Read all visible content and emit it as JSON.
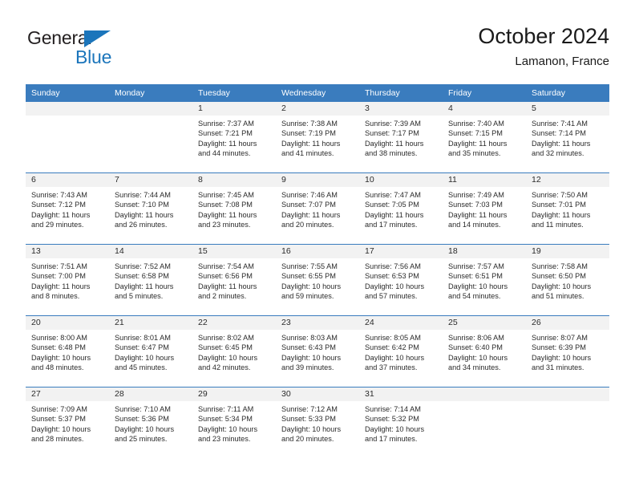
{
  "brand": {
    "name_part1": "General",
    "name_part2": "Blue",
    "triangle_color": "#1b75bb"
  },
  "header": {
    "title": "October 2024",
    "subtitle": "Lamanon, France",
    "header_bg": "#3a7cbe",
    "band_bg": "#f2f2f2"
  },
  "weekdays": [
    "Sunday",
    "Monday",
    "Tuesday",
    "Wednesday",
    "Thursday",
    "Friday",
    "Saturday"
  ],
  "weeks": [
    [
      {
        "day": "",
        "sunrise": "",
        "sunset": "",
        "daylight_line1": "",
        "daylight_line2": ""
      },
      {
        "day": "",
        "sunrise": "",
        "sunset": "",
        "daylight_line1": "",
        "daylight_line2": ""
      },
      {
        "day": "1",
        "sunrise": "Sunrise: 7:37 AM",
        "sunset": "Sunset: 7:21 PM",
        "daylight_line1": "Daylight: 11 hours",
        "daylight_line2": "and 44 minutes."
      },
      {
        "day": "2",
        "sunrise": "Sunrise: 7:38 AM",
        "sunset": "Sunset: 7:19 PM",
        "daylight_line1": "Daylight: 11 hours",
        "daylight_line2": "and 41 minutes."
      },
      {
        "day": "3",
        "sunrise": "Sunrise: 7:39 AM",
        "sunset": "Sunset: 7:17 PM",
        "daylight_line1": "Daylight: 11 hours",
        "daylight_line2": "and 38 minutes."
      },
      {
        "day": "4",
        "sunrise": "Sunrise: 7:40 AM",
        "sunset": "Sunset: 7:15 PM",
        "daylight_line1": "Daylight: 11 hours",
        "daylight_line2": "and 35 minutes."
      },
      {
        "day": "5",
        "sunrise": "Sunrise: 7:41 AM",
        "sunset": "Sunset: 7:14 PM",
        "daylight_line1": "Daylight: 11 hours",
        "daylight_line2": "and 32 minutes."
      }
    ],
    [
      {
        "day": "6",
        "sunrise": "Sunrise: 7:43 AM",
        "sunset": "Sunset: 7:12 PM",
        "daylight_line1": "Daylight: 11 hours",
        "daylight_line2": "and 29 minutes."
      },
      {
        "day": "7",
        "sunrise": "Sunrise: 7:44 AM",
        "sunset": "Sunset: 7:10 PM",
        "daylight_line1": "Daylight: 11 hours",
        "daylight_line2": "and 26 minutes."
      },
      {
        "day": "8",
        "sunrise": "Sunrise: 7:45 AM",
        "sunset": "Sunset: 7:08 PM",
        "daylight_line1": "Daylight: 11 hours",
        "daylight_line2": "and 23 minutes."
      },
      {
        "day": "9",
        "sunrise": "Sunrise: 7:46 AM",
        "sunset": "Sunset: 7:07 PM",
        "daylight_line1": "Daylight: 11 hours",
        "daylight_line2": "and 20 minutes."
      },
      {
        "day": "10",
        "sunrise": "Sunrise: 7:47 AM",
        "sunset": "Sunset: 7:05 PM",
        "daylight_line1": "Daylight: 11 hours",
        "daylight_line2": "and 17 minutes."
      },
      {
        "day": "11",
        "sunrise": "Sunrise: 7:49 AM",
        "sunset": "Sunset: 7:03 PM",
        "daylight_line1": "Daylight: 11 hours",
        "daylight_line2": "and 14 minutes."
      },
      {
        "day": "12",
        "sunrise": "Sunrise: 7:50 AM",
        "sunset": "Sunset: 7:01 PM",
        "daylight_line1": "Daylight: 11 hours",
        "daylight_line2": "and 11 minutes."
      }
    ],
    [
      {
        "day": "13",
        "sunrise": "Sunrise: 7:51 AM",
        "sunset": "Sunset: 7:00 PM",
        "daylight_line1": "Daylight: 11 hours",
        "daylight_line2": "and 8 minutes."
      },
      {
        "day": "14",
        "sunrise": "Sunrise: 7:52 AM",
        "sunset": "Sunset: 6:58 PM",
        "daylight_line1": "Daylight: 11 hours",
        "daylight_line2": "and 5 minutes."
      },
      {
        "day": "15",
        "sunrise": "Sunrise: 7:54 AM",
        "sunset": "Sunset: 6:56 PM",
        "daylight_line1": "Daylight: 11 hours",
        "daylight_line2": "and 2 minutes."
      },
      {
        "day": "16",
        "sunrise": "Sunrise: 7:55 AM",
        "sunset": "Sunset: 6:55 PM",
        "daylight_line1": "Daylight: 10 hours",
        "daylight_line2": "and 59 minutes."
      },
      {
        "day": "17",
        "sunrise": "Sunrise: 7:56 AM",
        "sunset": "Sunset: 6:53 PM",
        "daylight_line1": "Daylight: 10 hours",
        "daylight_line2": "and 57 minutes."
      },
      {
        "day": "18",
        "sunrise": "Sunrise: 7:57 AM",
        "sunset": "Sunset: 6:51 PM",
        "daylight_line1": "Daylight: 10 hours",
        "daylight_line2": "and 54 minutes."
      },
      {
        "day": "19",
        "sunrise": "Sunrise: 7:58 AM",
        "sunset": "Sunset: 6:50 PM",
        "daylight_line1": "Daylight: 10 hours",
        "daylight_line2": "and 51 minutes."
      }
    ],
    [
      {
        "day": "20",
        "sunrise": "Sunrise: 8:00 AM",
        "sunset": "Sunset: 6:48 PM",
        "daylight_line1": "Daylight: 10 hours",
        "daylight_line2": "and 48 minutes."
      },
      {
        "day": "21",
        "sunrise": "Sunrise: 8:01 AM",
        "sunset": "Sunset: 6:47 PM",
        "daylight_line1": "Daylight: 10 hours",
        "daylight_line2": "and 45 minutes."
      },
      {
        "day": "22",
        "sunrise": "Sunrise: 8:02 AM",
        "sunset": "Sunset: 6:45 PM",
        "daylight_line1": "Daylight: 10 hours",
        "daylight_line2": "and 42 minutes."
      },
      {
        "day": "23",
        "sunrise": "Sunrise: 8:03 AM",
        "sunset": "Sunset: 6:43 PM",
        "daylight_line1": "Daylight: 10 hours",
        "daylight_line2": "and 39 minutes."
      },
      {
        "day": "24",
        "sunrise": "Sunrise: 8:05 AM",
        "sunset": "Sunset: 6:42 PM",
        "daylight_line1": "Daylight: 10 hours",
        "daylight_line2": "and 37 minutes."
      },
      {
        "day": "25",
        "sunrise": "Sunrise: 8:06 AM",
        "sunset": "Sunset: 6:40 PM",
        "daylight_line1": "Daylight: 10 hours",
        "daylight_line2": "and 34 minutes."
      },
      {
        "day": "26",
        "sunrise": "Sunrise: 8:07 AM",
        "sunset": "Sunset: 6:39 PM",
        "daylight_line1": "Daylight: 10 hours",
        "daylight_line2": "and 31 minutes."
      }
    ],
    [
      {
        "day": "27",
        "sunrise": "Sunrise: 7:09 AM",
        "sunset": "Sunset: 5:37 PM",
        "daylight_line1": "Daylight: 10 hours",
        "daylight_line2": "and 28 minutes."
      },
      {
        "day": "28",
        "sunrise": "Sunrise: 7:10 AM",
        "sunset": "Sunset: 5:36 PM",
        "daylight_line1": "Daylight: 10 hours",
        "daylight_line2": "and 25 minutes."
      },
      {
        "day": "29",
        "sunrise": "Sunrise: 7:11 AM",
        "sunset": "Sunset: 5:34 PM",
        "daylight_line1": "Daylight: 10 hours",
        "daylight_line2": "and 23 minutes."
      },
      {
        "day": "30",
        "sunrise": "Sunrise: 7:12 AM",
        "sunset": "Sunset: 5:33 PM",
        "daylight_line1": "Daylight: 10 hours",
        "daylight_line2": "and 20 minutes."
      },
      {
        "day": "31",
        "sunrise": "Sunrise: 7:14 AM",
        "sunset": "Sunset: 5:32 PM",
        "daylight_line1": "Daylight: 10 hours",
        "daylight_line2": "and 17 minutes."
      },
      {
        "day": "",
        "sunrise": "",
        "sunset": "",
        "daylight_line1": "",
        "daylight_line2": ""
      },
      {
        "day": "",
        "sunrise": "",
        "sunset": "",
        "daylight_line1": "",
        "daylight_line2": ""
      }
    ]
  ]
}
